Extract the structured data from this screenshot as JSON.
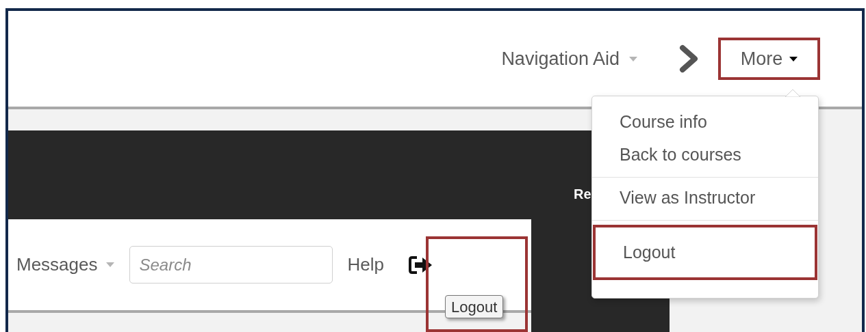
{
  "header": {
    "navigation_aid": {
      "label": "Navigation Aid"
    },
    "more_menu": {
      "label": "More",
      "expanded": true,
      "highlighted": true,
      "groups": [
        [
          {
            "label": "Course info",
            "highlighted": false
          },
          {
            "label": "Back to courses",
            "highlighted": false
          }
        ],
        [
          {
            "label": "View as Instructor",
            "highlighted": false
          }
        ],
        [
          {
            "label": "Logout",
            "highlighted": true
          }
        ]
      ]
    }
  },
  "dark_panel": {
    "heading": "Re"
  },
  "course_nav": {
    "messages": {
      "label": "Messages"
    },
    "search": {
      "placeholder": "Search"
    },
    "help": {
      "label": "Help"
    },
    "logout": {
      "tooltip": "Logout",
      "highlighted": true
    }
  }
}
